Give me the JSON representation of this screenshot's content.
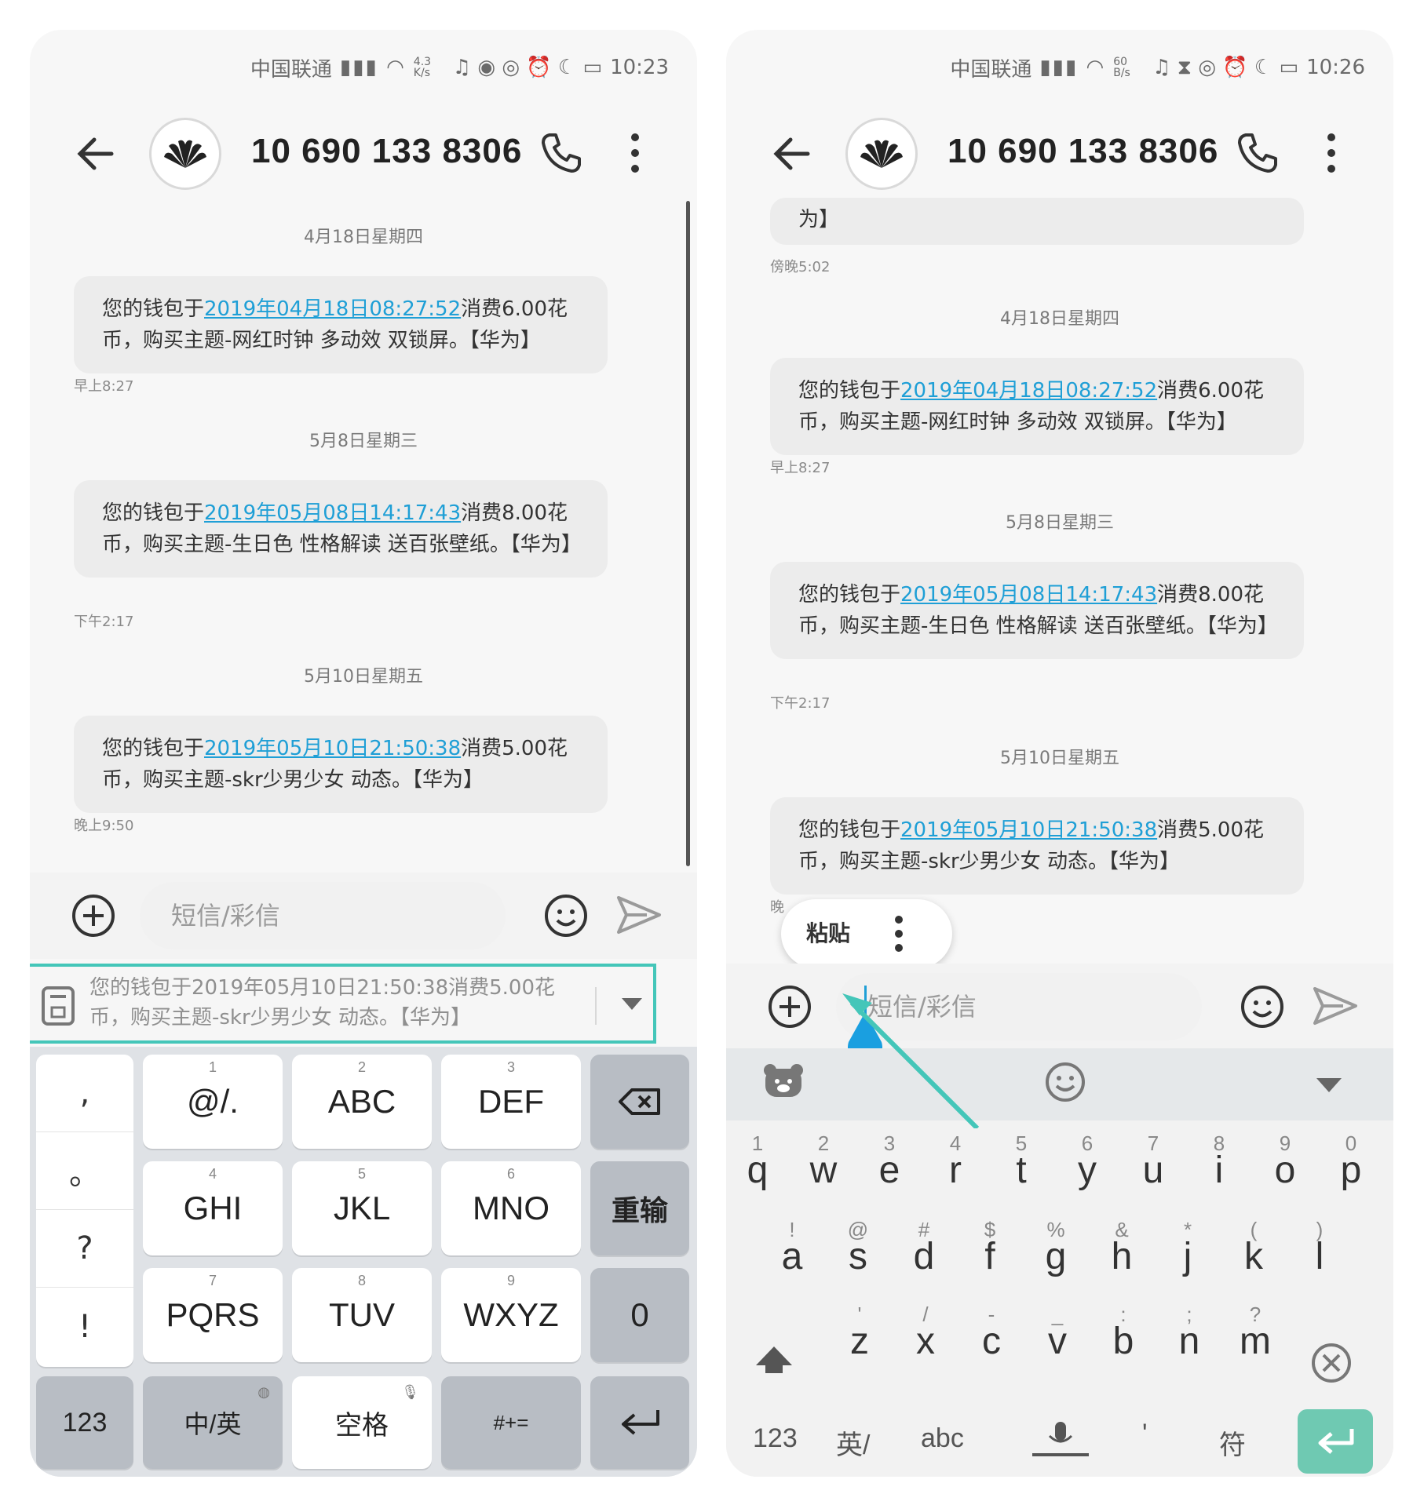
{
  "left": {
    "status": {
      "carrier": "中国联通",
      "speed": "4.3 K/s",
      "time": "10:23"
    },
    "contact": "10 690 133 8306",
    "messages": [
      {
        "date": "4月18日星期四",
        "pre": "您的钱包于",
        "link": "2019年04月18日08:27:52",
        "post": "消费6.00花币，购买主题-网红时钟 多动效 双锁屏。【华为】",
        "time": "早上8:27"
      },
      {
        "date": "5月8日星期三",
        "pre": "您的钱包于",
        "link": "2019年05月08日14:17:43",
        "post": "消费8.00花币，购买主题-生日色 性格解读 送百张壁纸。【华为】",
        "time": "下午2:17"
      },
      {
        "date": "5月10日星期五",
        "pre": "您的钱包于",
        "link": "2019年05月10日21:50:38",
        "post": "消费5.00花币，购买主题-skr少男少女 动态。【华为】",
        "time": "晚上9:50"
      }
    ],
    "input_placeholder": "短信/彩信",
    "clipboard_text": "您的钱包于2019年05月10日21:50:38消费5.00花币，购买主题-skr少男少女 动态。【华为】",
    "keyboard": {
      "symbols": [
        ",",
        "。",
        "?",
        "!"
      ],
      "keys": [
        {
          "num": "1",
          "label": "@/."
        },
        {
          "num": "2",
          "label": "ABC"
        },
        {
          "num": "3",
          "label": "DEF"
        },
        {
          "num": "4",
          "label": "GHI"
        },
        {
          "num": "5",
          "label": "JKL"
        },
        {
          "num": "6",
          "label": "MNO"
        },
        {
          "num": "7",
          "label": "PQRS"
        },
        {
          "num": "8",
          "label": "TUV"
        },
        {
          "num": "9",
          "label": "WXYZ"
        }
      ],
      "reinput": "重输",
      "zero": "0",
      "k123": "123",
      "lang": "中/英",
      "space": "空格",
      "sym": "#+="
    }
  },
  "right": {
    "status": {
      "carrier": "中国联通",
      "speed": "60 B/s",
      "time": "10:26"
    },
    "contact": "10 690 133 8306",
    "partial_bubble": "为】",
    "partial_time": "傍晚5:02",
    "messages": [
      {
        "date": "4月18日星期四",
        "pre": "您的钱包于",
        "link": "2019年04月18日08:27:52",
        "post": "消费6.00花币，购买主题-网红时钟 多动效 双锁屏。【华为】",
        "time": "早上8:27"
      },
      {
        "date": "5月8日星期三",
        "pre": "您的钱包于",
        "link": "2019年05月08日14:17:43",
        "post": "消费8.00花币，购买主题-生日色 性格解读 送百张壁纸。【华为】",
        "time": "下午2:17"
      },
      {
        "date": "5月10日星期五",
        "pre": "您的钱包于",
        "link": "2019年05月10日21:50:38",
        "post": "消费5.00花币，购买主题-skr少男少女 动态。【华为】",
        "time": "晚"
      }
    ],
    "paste_label": "粘贴",
    "input_placeholder": "短信/彩信",
    "qwerty": {
      "row1_hints": [
        "1",
        "2",
        "3",
        "4",
        "5",
        "6",
        "7",
        "8",
        "9",
        "0"
      ],
      "row1": [
        "q",
        "w",
        "e",
        "r",
        "t",
        "y",
        "u",
        "i",
        "o",
        "p"
      ],
      "row2_hints": [
        "!",
        "@",
        "#",
        "$",
        "%",
        "&",
        "*",
        "(",
        ")"
      ],
      "row2": [
        "a",
        "s",
        "d",
        "f",
        "g",
        "h",
        "j",
        "k",
        "l"
      ],
      "row3_hints": [
        "'",
        "/",
        "-",
        "_",
        ":",
        ";",
        "?"
      ],
      "row3": [
        "z",
        "x",
        "c",
        "v",
        "b",
        "n",
        "m"
      ],
      "bottom": {
        "k123": "123",
        "lang": "英/",
        "abc": "abc",
        "comma": "'",
        "fu": "符"
      }
    },
    "annotation_color": "#44c6b9"
  }
}
